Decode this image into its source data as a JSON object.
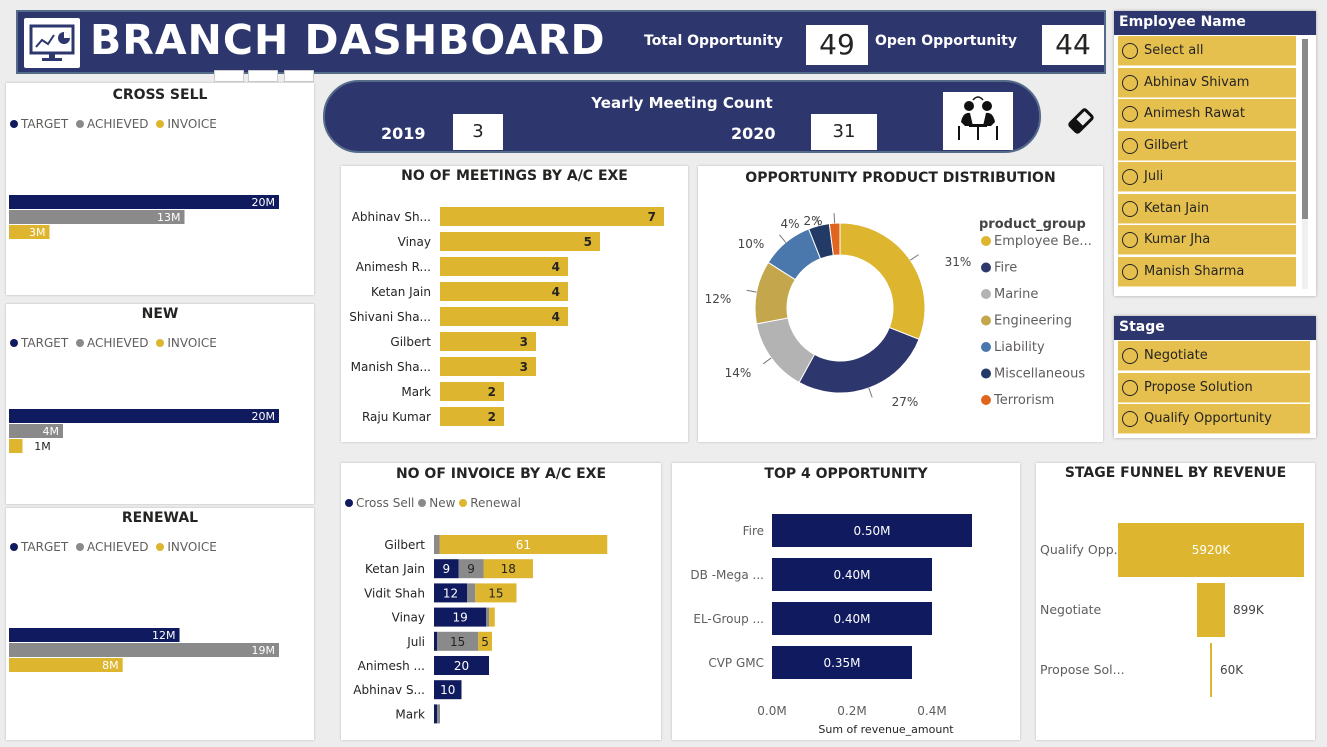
{
  "header": {
    "title": "BRANCH DASHBOARD",
    "total_label": "Total Opportunity",
    "total_value": "49",
    "open_label": "Open Opportunity",
    "open_value": "44",
    "icon": "dashboard-monitor-icon"
  },
  "meetings_box": {
    "title": "Yearly Meeting Count",
    "year1": "2019",
    "count1": "3",
    "year2": "2020",
    "count2": "31",
    "icon": "meeting-people-icon"
  },
  "eraser_icon": "eraser-icon",
  "colors": {
    "navy": "#0f1a5f",
    "gray": "#8a8a8a",
    "gold": "#ddb52f",
    "header_bg": "#2e376d",
    "slicer_item": "#e6c04e"
  },
  "employee_slicer": {
    "title": "Employee Name",
    "items": [
      "Select all",
      "Abhinav Shivam",
      "Animesh Rawat",
      "Gilbert",
      "Juli",
      "Ketan Jain",
      "Kumar Jha",
      "Manish Sharma"
    ]
  },
  "stage_slicer": {
    "title": "Stage",
    "items": [
      "Negotiate",
      "Propose Solution",
      "Qualify Opportunity"
    ]
  },
  "chart_data": [
    {
      "id": "cross_sell",
      "type": "bar",
      "title": "CROSS SELL",
      "legend": [
        "TARGET",
        "ACHIEVED",
        "INVOICE"
      ],
      "series": [
        {
          "name": "TARGET",
          "value": 20,
          "label": "20M",
          "color": "#0f1a5f"
        },
        {
          "name": "ACHIEVED",
          "value": 13,
          "label": "13M",
          "color": "#8a8a8a"
        },
        {
          "name": "INVOICE",
          "value": 3,
          "label": "3M",
          "color": "#ddb52f"
        }
      ],
      "unit": "M"
    },
    {
      "id": "new",
      "type": "bar",
      "title": "NEW",
      "legend": [
        "TARGET",
        "ACHIEVED",
        "INVOICE"
      ],
      "series": [
        {
          "name": "TARGET",
          "value": 20,
          "label": "20M",
          "color": "#0f1a5f"
        },
        {
          "name": "ACHIEVED",
          "value": 4,
          "label": "4M",
          "color": "#8a8a8a"
        },
        {
          "name": "INVOICE",
          "value": 1,
          "label": "1M",
          "color": "#ddb52f"
        }
      ],
      "unit": "M"
    },
    {
      "id": "renewal",
      "type": "bar",
      "title": "RENEWAL",
      "legend": [
        "TARGET",
        "ACHIEVED",
        "INVOICE"
      ],
      "series": [
        {
          "name": "TARGET",
          "value": 12,
          "label": "12M",
          "color": "#0f1a5f"
        },
        {
          "name": "ACHIEVED",
          "value": 19,
          "label": "19M",
          "color": "#8a8a8a"
        },
        {
          "name": "INVOICE",
          "value": 8,
          "label": "8M",
          "color": "#ddb52f"
        }
      ],
      "unit": "M"
    },
    {
      "id": "meetings",
      "type": "bar",
      "title": "NO OF MEETINGS BY A/C EXE",
      "categories": [
        "Abhinav Sh...",
        "Vinay",
        "Animesh R...",
        "Ketan Jain",
        "Shivani Sha...",
        "Gilbert",
        "Manish Sha...",
        "Mark",
        "Raju Kumar"
      ],
      "values": [
        7,
        5,
        4,
        4,
        4,
        3,
        3,
        2,
        2
      ]
    },
    {
      "id": "product_dist",
      "type": "pie",
      "title": "OPPORTUNITY PRODUCT DISTRIBUTION",
      "legend_title": "product_group",
      "slices": [
        {
          "name": "Employee Be...",
          "value": 31,
          "label": "31%",
          "color": "#ddb52f"
        },
        {
          "name": "Fire",
          "value": 27,
          "label": "27%",
          "color": "#2e376d"
        },
        {
          "name": "Marine",
          "value": 14,
          "label": "14%",
          "color": "#b3b3b3"
        },
        {
          "name": "Engineering",
          "value": 12,
          "label": "12%",
          "color": "#c4a64c"
        },
        {
          "name": "Liability",
          "value": 10,
          "label": "10%",
          "color": "#4a77ac"
        },
        {
          "name": "Miscellaneous",
          "value": 4,
          "label": "4%",
          "color": "#243a66"
        },
        {
          "name": "Terrorism",
          "value": 2,
          "label": "2%",
          "color": "#e0661f"
        }
      ]
    },
    {
      "id": "invoice",
      "type": "bar",
      "title": "NO OF INVOICE BY A/C EXE",
      "legend": [
        "Cross Sell",
        "New",
        "Renewal"
      ],
      "categories": [
        "Gilbert",
        "Ketan Jain",
        "Vidit Shah",
        "Vinay",
        "Juli",
        "Animesh ...",
        "Abhinav S...",
        "Mark"
      ],
      "series": [
        {
          "name": "Cross Sell",
          "values": [
            0,
            9,
            12,
            19,
            1,
            20,
            10,
            1
          ],
          "color": "#0f1a5f"
        },
        {
          "name": "New",
          "values": [
            2,
            9,
            3,
            1,
            15,
            0,
            0,
            1
          ],
          "color": "#8a8a8a"
        },
        {
          "name": "Renewal",
          "values": [
            61,
            18,
            15,
            2,
            5,
            0,
            0,
            0
          ],
          "color": "#ddb52f"
        }
      ],
      "shown_labels": [
        [
          null,
          null,
          "61"
        ],
        [
          "9",
          "9",
          "18"
        ],
        [
          "12",
          null,
          "15"
        ],
        [
          "19",
          null,
          null
        ],
        [
          null,
          "15",
          "5"
        ],
        [
          "20",
          null,
          null
        ],
        [
          "10",
          null,
          null
        ],
        [
          null,
          null,
          null
        ]
      ]
    },
    {
      "id": "top4",
      "type": "bar",
      "title": "TOP 4 OPPORTUNITY",
      "categories": [
        "Fire",
        "DB -Mega ...",
        "EL-Group ...",
        "CVP GMC"
      ],
      "values": [
        0.5,
        0.4,
        0.4,
        0.35
      ],
      "value_labels": [
        "0.50M",
        "0.40M",
        "0.40M",
        "0.35M"
      ],
      "xticks": [
        "0.0M",
        "0.2M",
        "0.4M"
      ],
      "xlabel": "Sum of revenue_amount",
      "xlim": [
        0,
        0.5
      ]
    },
    {
      "id": "funnel",
      "type": "bar",
      "title": "STAGE FUNNEL BY REVENUE",
      "categories": [
        "Qualify Opp...",
        "Negotiate",
        "Propose Sol..."
      ],
      "values": [
        5920,
        899,
        60
      ],
      "value_labels": [
        "5920K",
        "899K",
        "60K"
      ]
    }
  ]
}
